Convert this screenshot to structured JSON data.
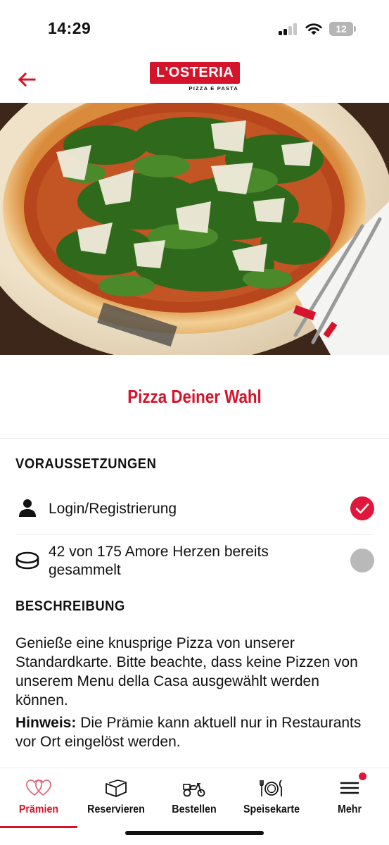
{
  "status_bar": {
    "time": "14:29",
    "battery_level": "12",
    "icons": [
      "signal-icon",
      "wifi-icon",
      "battery-icon"
    ]
  },
  "header": {
    "back_icon": "arrow-left-icon",
    "logo_text": "L'OSTERIA",
    "logo_subtitle": "PIZZA E PASTA",
    "brand_color": "#d5132a"
  },
  "hero": {
    "image": "pizza-with-arugula-photo"
  },
  "offer": {
    "title": "Pizza Deiner Wahl"
  },
  "requirements": {
    "heading": "VORAUSSETZUNGEN",
    "items": [
      {
        "icon": "person-icon",
        "label": "Login/Registrierung",
        "status": "done"
      },
      {
        "icon": "coin-icon",
        "label": "42 von 175 Amore Herzen bereits gesammelt",
        "status": "open"
      }
    ]
  },
  "description": {
    "heading": "BESCHREIBUNG",
    "text": "Genieße eine knusprige Pizza von unserer Standardkarte. Bitte beachte, dass keine Pizzen von unserem Menu della Casa ausgewählt werden können.",
    "note_label": "Hinweis:",
    "note_text": " Die Prämie kann aktuell nur in Restaurants vor Ort eingelöst werden."
  },
  "bottom_nav": {
    "items": [
      {
        "label": "Prämien",
        "icon": "hearts-icon",
        "active": true
      },
      {
        "label": "Reservieren",
        "icon": "book-icon",
        "active": false
      },
      {
        "label": "Bestellen",
        "icon": "scooter-icon",
        "active": false
      },
      {
        "label": "Speisekarte",
        "icon": "plate-cutlery-icon",
        "active": false
      },
      {
        "label": "Mehr",
        "icon": "menu-icon",
        "active": false,
        "badge": true
      }
    ],
    "active_color": "#d5132a"
  }
}
